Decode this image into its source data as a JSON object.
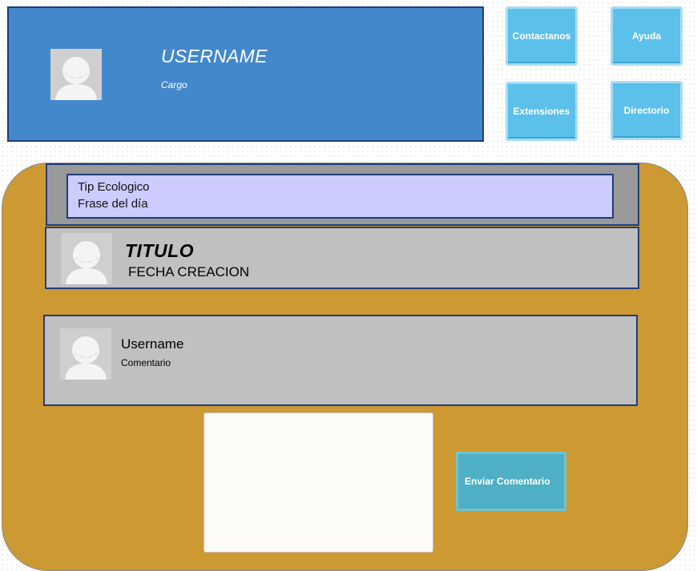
{
  "profile": {
    "username": "USERNAME",
    "cargo": "Cargo"
  },
  "nav": {
    "contactanos": "Contactanos",
    "ayuda": "Ayuda",
    "extensiones": "Extensiones",
    "directorio": "Directorio"
  },
  "tip": {
    "line1": "Tip Ecologico",
    "line2": "Frase del día"
  },
  "post": {
    "title": "TITULO",
    "date": "FECHA CREACION"
  },
  "comment": {
    "username": "Username",
    "text": "Comentario"
  },
  "form": {
    "comment_value": "",
    "send_label": "Enviar Comentario"
  },
  "colors": {
    "profile_bg": "#4488cc",
    "tile_bg": "#5bc0ea",
    "panel_bg": "#cc9933",
    "tip_bg": "#ccccff",
    "card_bg": "#c0c0c0",
    "send_bg": "#4fafc4"
  },
  "icons": {
    "avatar": "user-avatar-placeholder-icon"
  }
}
